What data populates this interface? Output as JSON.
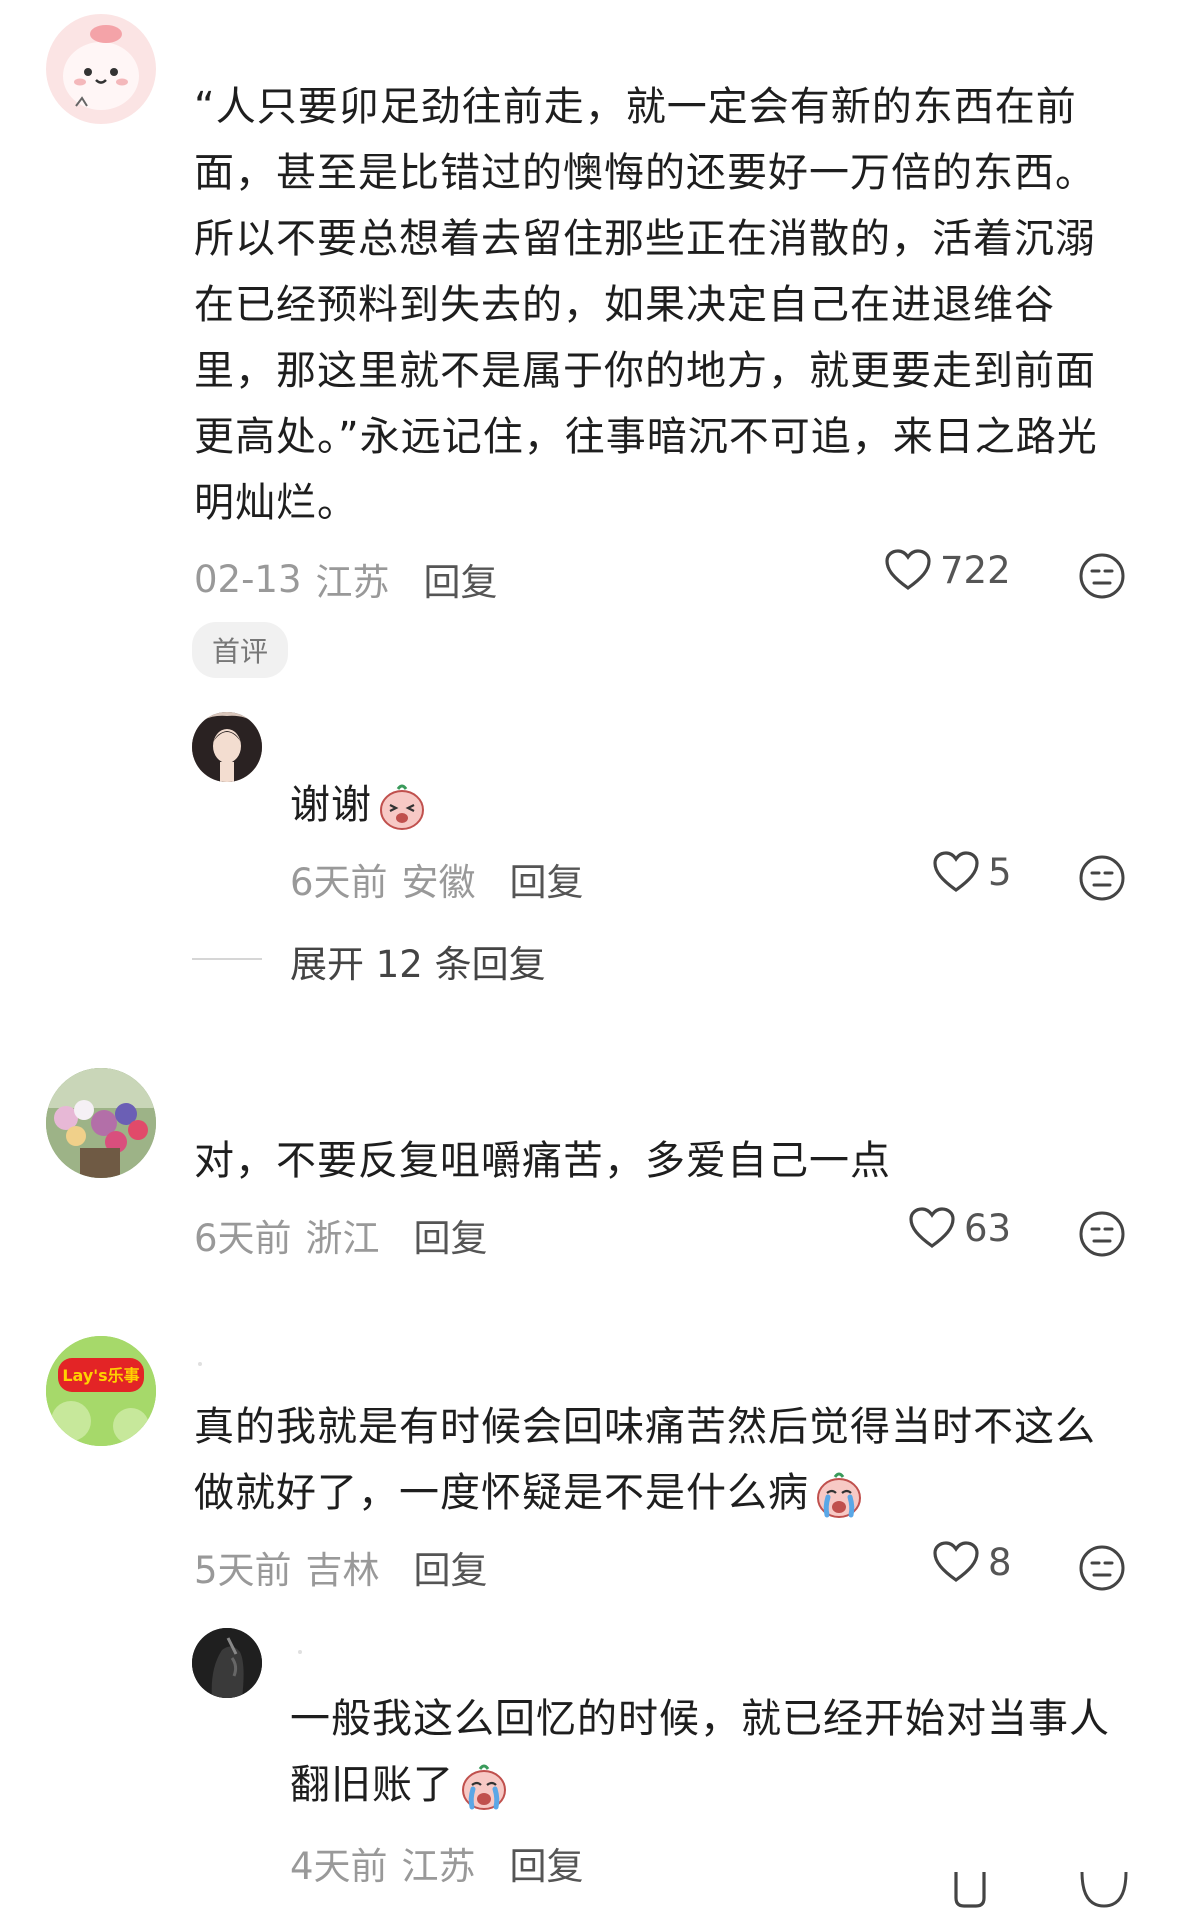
{
  "comments": [
    {
      "text": "“人只要卯足劲往前走，就一定会有新的东西在前面，甚至是比错过的懊悔的还要好一万倍的东西。所以不要总想着去留住那些正在消散的，活着沉溺在已经预料到失去的，如果决定自己在进退维谷里，那这里就不是属于你的地方，就更要走到前面更高处。”永远记住，往事暗沉不可追，来日之路光明灿烂。",
      "date": "02-13",
      "location": "江苏",
      "reply_label": "回复",
      "likes": "722",
      "badge": "首评",
      "replies": [
        {
          "text": "谢谢",
          "date": "6天前",
          "location": "安徽",
          "reply_label": "回复",
          "likes": "5"
        }
      ],
      "expand_label": "展开 12 条回复"
    },
    {
      "text": "对，不要反复咀嚼痛苦，多爱自己一点",
      "date": "6天前",
      "location": "浙江",
      "reply_label": "回复",
      "likes": "63"
    },
    {
      "text": "真的我就是有时候会回味痛苦然后觉得当时不这么做就好了，一度怀疑是不是什么病",
      "date": "5天前",
      "location": "吉林",
      "reply_label": "回复",
      "likes": "8",
      "avatar_text": "Lay's乐事",
      "replies": [
        {
          "text": "一般我这么回忆的时候，就已经开始对当事人翻旧账了",
          "date": "4天前",
          "location": "江苏",
          "reply_label": "回复"
        }
      ]
    }
  ],
  "colors": {
    "text": "#1e1e1e",
    "meta": "#999999",
    "badge_bg": "#f1f1f1"
  }
}
